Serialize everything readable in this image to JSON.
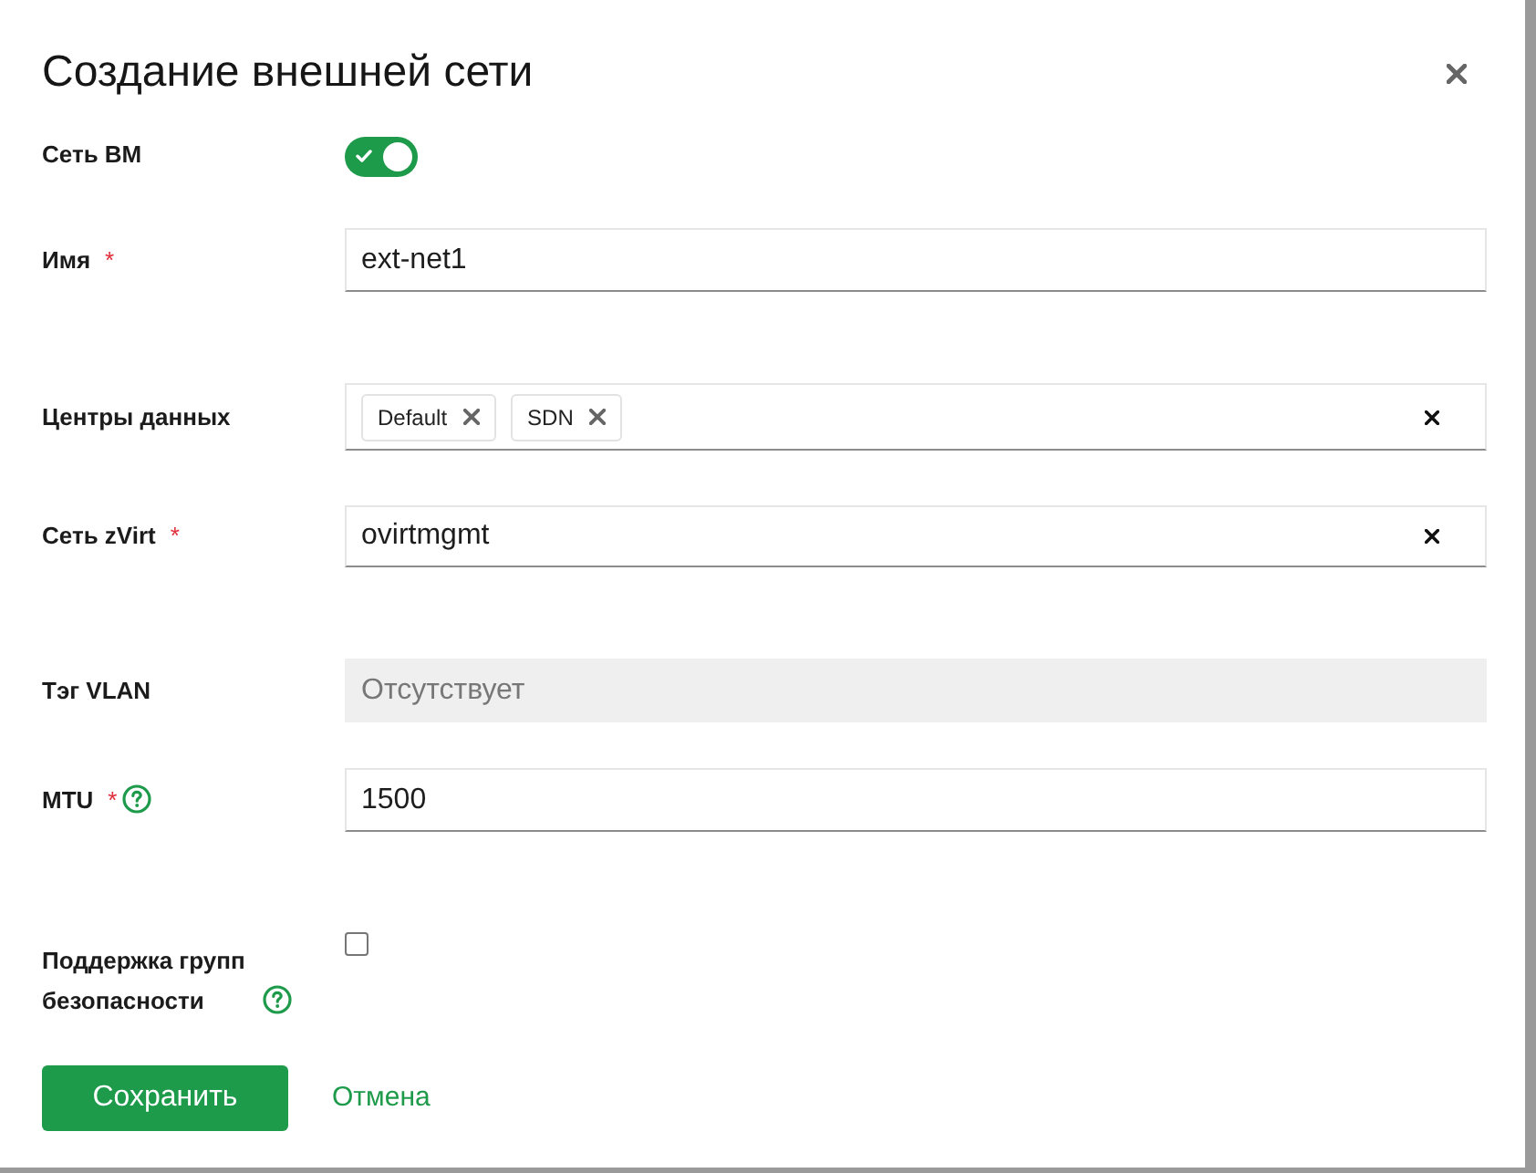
{
  "dialog": {
    "title": "Создание внешней сети"
  },
  "fields": [
    {
      "kind": "toggle",
      "label": "Сеть ВМ",
      "help": false,
      "disabled": false,
      "on": true
    },
    {
      "kind": "text",
      "label": "Имя",
      "required_mark": "*",
      "help": false,
      "disabled": false,
      "value": "ext-net1"
    },
    {
      "kind": "tags",
      "label": "Центры данных",
      "help": false,
      "disabled": false,
      "tags": [
        "Default",
        "SDN"
      ]
    },
    {
      "kind": "select",
      "label": "Сеть zVirt",
      "required_mark": "*",
      "help": false,
      "disabled": false,
      "value": "ovirtmgmt"
    },
    {
      "kind": "text",
      "label": "Тэг VLAN",
      "help": false,
      "disabled": true,
      "placeholder": "Отсутствует"
    },
    {
      "kind": "text",
      "label": "MTU",
      "required_mark": "*",
      "help": true,
      "disabled": false,
      "value": "1500"
    },
    {
      "kind": "checkbox",
      "label": "Поддержка групп безопасности",
      "help": true,
      "disabled": false,
      "checked": false
    }
  ],
  "buttons": [
    {
      "kind": "primary",
      "label": "Сохранить"
    },
    {
      "kind": "link",
      "label": "Отмена"
    }
  ]
}
